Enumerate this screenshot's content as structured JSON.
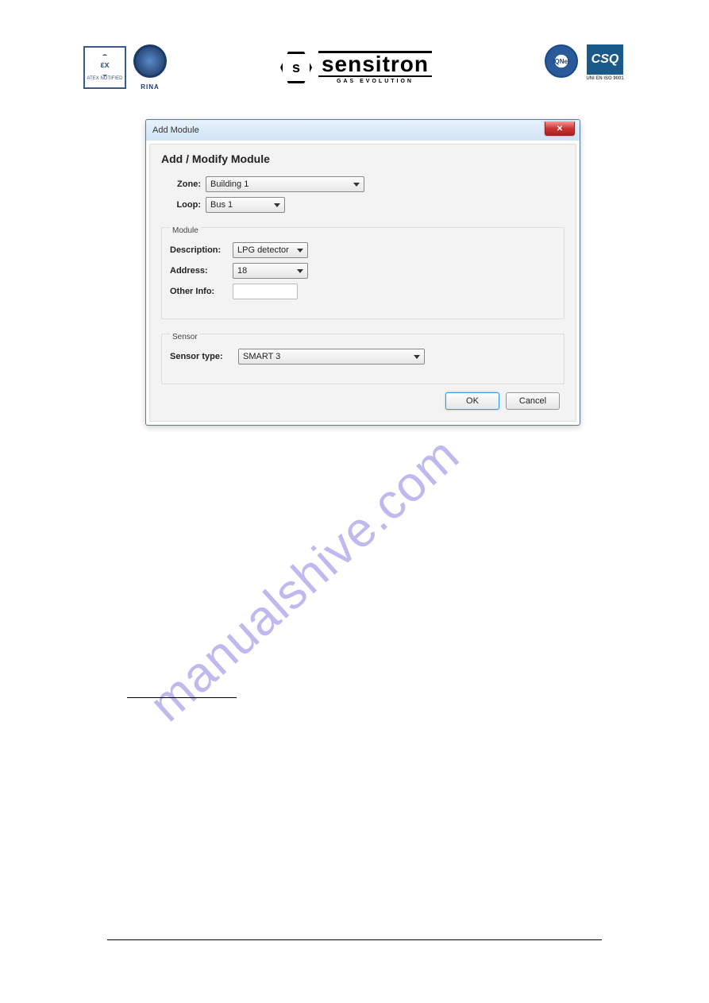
{
  "header": {
    "ex_label": "ATEX NOTIFIED",
    "ex_symbol": "εx",
    "rina_label": "RINA",
    "brand": "sensitron",
    "brand_sub": "GAS  EVOLUTION",
    "brand_symbol": "s",
    "iqnet": "IQNet",
    "csq": "CSQ",
    "csq_sub": "UNI EN ISO 9001"
  },
  "watermark": "manualshive.com",
  "dialog": {
    "window_title": "Add Module",
    "title": "Add / Modify Module",
    "zone_label": "Zone:",
    "zone_value": "Building 1",
    "loop_label": "Loop:",
    "loop_value": "Bus 1",
    "module_legend": "Module",
    "desc_label": "Description:",
    "desc_value": "LPG detector",
    "addr_label": "Address:",
    "addr_value": "18",
    "other_label": "Other Info:",
    "other_value": "",
    "sensor_legend": "Sensor",
    "sensor_type_label": "Sensor type:",
    "sensor_type_value": "SMART 3",
    "ok_label": "OK",
    "cancel_label": "Cancel"
  }
}
